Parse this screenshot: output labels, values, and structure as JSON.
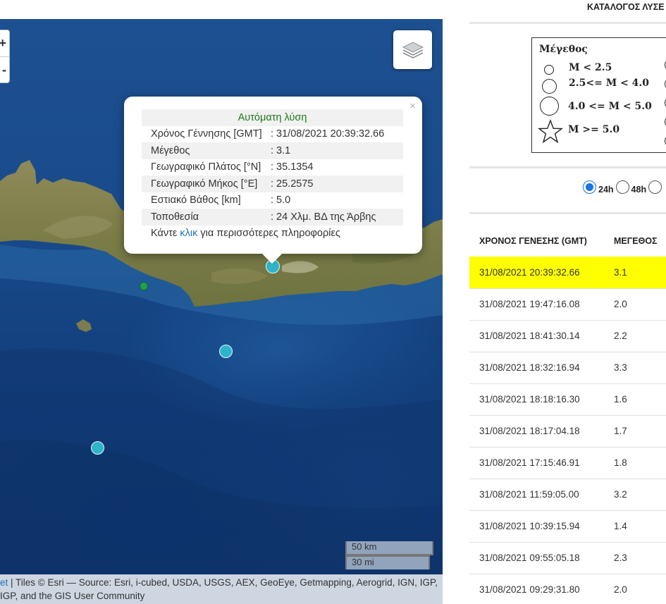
{
  "map": {
    "zoom_in": "+",
    "zoom_out": "-",
    "layers_icon": "layers-icon",
    "popup": {
      "title": "Αυτόματη λύση",
      "close": "×",
      "rows": [
        {
          "label": "Χρόνος Γέννησης [GMT]",
          "value": ": 31/08/2021 20:39:32.66"
        },
        {
          "label": "Μέγεθος",
          "value": ": 3.1"
        },
        {
          "label": "Γεωγραφικό Πλάτος [°N]",
          "value": ": 35.1354"
        },
        {
          "label": "Γεωγραφικό Μήκος [°E]",
          "value": ": 25.2575"
        },
        {
          "label": "Εστιακό Βάθος [km]",
          "value": ": 5.0"
        },
        {
          "label": "Τοποθεσία",
          "value": ": 24 Χλμ. ΒΔ της Άρβης"
        }
      ],
      "more_prefix": "Κάντε ",
      "more_link": "κλικ",
      "more_suffix": " για περισσότερες πληροφορίες"
    },
    "scale_km": "50 km",
    "scale_mi": "30 mi",
    "attribution_line1_link": "et",
    "attribution_line1_text": " | Tiles © Esri — Source: Esri, i-cubed, USDA, USGS, AEX, GeoEye, Getmapping, Aerogrid, IGN, IGP,",
    "attribution_line2": "IGP, and the GIS User Community"
  },
  "panel": {
    "catalog_title": "ΚΑΤΑΛΟΓΟΣ ΛΥΣΕ",
    "legend": {
      "title": "Μέγεθος",
      "items": [
        "M < 2.5",
        "2.5<= M < 4.0",
        "4.0 <= M < 5.0",
        "M >= 5.0"
      ]
    },
    "radios": [
      {
        "label": "24h",
        "checked": true
      },
      {
        "label": "48h",
        "checked": false
      },
      {
        "label": "",
        "checked": false
      }
    ],
    "table": {
      "headers": [
        "ΧΡΟΝΟΣ ΓΕΝΕΣΗΣ (GMT)",
        "ΜΕΓΕΘΟΣ"
      ],
      "rows": [
        {
          "time": "31/08/2021 20:39:32.66",
          "mag": "3.1",
          "highlight": true
        },
        {
          "time": "31/08/2021 19:47:16.08",
          "mag": "2.0"
        },
        {
          "time": "31/08/2021 18:41:30.14",
          "mag": "2.2"
        },
        {
          "time": "31/08/2021 18:32:16.94",
          "mag": "3.3"
        },
        {
          "time": "31/08/2021 18:18:16.30",
          "mag": "1.6"
        },
        {
          "time": "31/08/2021 18:17:04.18",
          "mag": "1.7"
        },
        {
          "time": "31/08/2021 17:15:46.91",
          "mag": "1.8"
        },
        {
          "time": "31/08/2021 11:59:05.00",
          "mag": "3.2"
        },
        {
          "time": "31/08/2021 10:39:15.94",
          "mag": "1.4"
        },
        {
          "time": "31/08/2021 09:55:05.18",
          "mag": "2.3"
        },
        {
          "time": "31/08/2021 09:29:31.80",
          "mag": "2.0"
        }
      ]
    }
  }
}
